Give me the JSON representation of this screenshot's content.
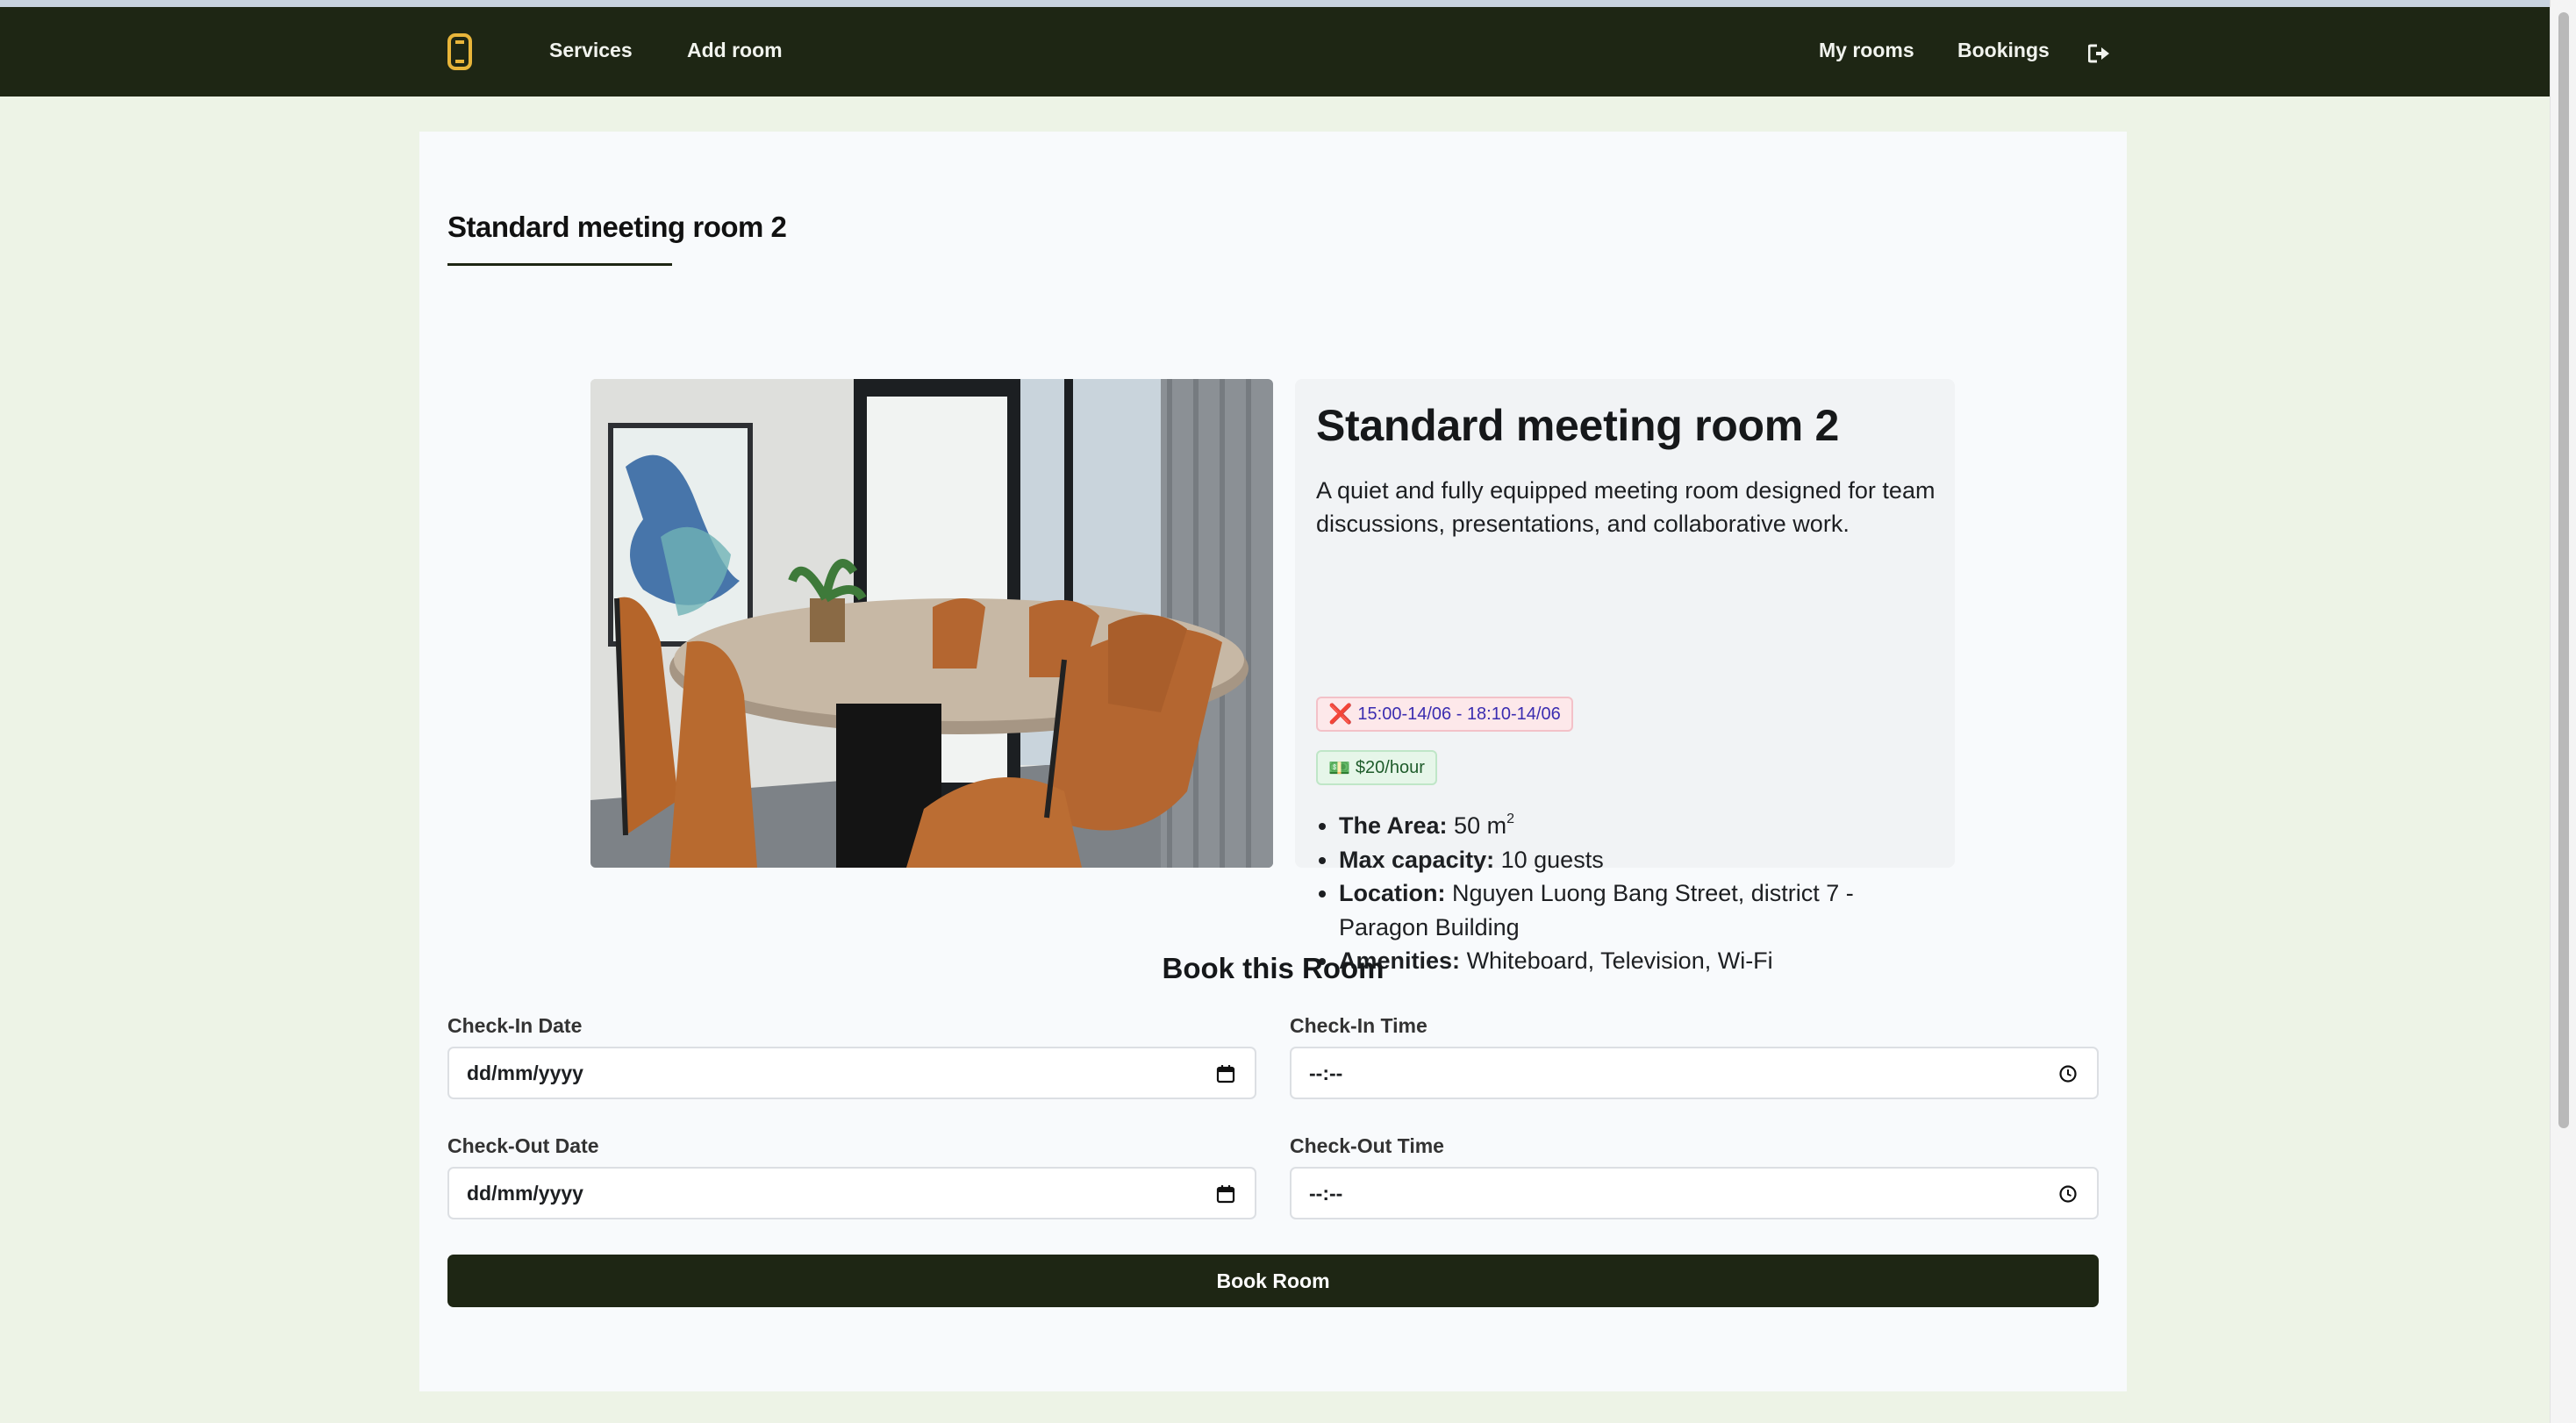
{
  "navbar": {
    "logo_icon": "link-logo-icon",
    "links": {
      "services": "Services",
      "add_room": "Add room",
      "my_rooms": "My rooms",
      "bookings": "Bookings"
    },
    "logout_icon": "sign-out-icon"
  },
  "page": {
    "title": "Standard meeting room 2"
  },
  "room": {
    "name": "Standard meeting room 2",
    "description": "A quiet and fully equipped meeting room designed for team discussions, presentations, and collaborative work.",
    "booked_slot": {
      "icon": "❌",
      "text": "15:00-14/06 - 18:10-14/06"
    },
    "price": {
      "icon": "💵",
      "text": "$20/hour"
    },
    "details": {
      "area_label": "The Area:",
      "area_value": "50 m",
      "area_unit_exp": "2",
      "capacity_label": "Max capacity:",
      "capacity_value": "10 guests",
      "location_label": "Location:",
      "location_value": "Nguyen Luong Bang Street, district 7 - Paragon Building",
      "amenities_label": "Amenities:",
      "amenities_value": "Whiteboard, Television, Wi-Fi"
    }
  },
  "booking": {
    "heading": "Book this Room",
    "check_in_date": {
      "label": "Check-In Date",
      "value": "dd/mm/yyyy",
      "icon": "calendar-icon"
    },
    "check_in_time": {
      "label": "Check-In Time",
      "value": "--:--",
      "icon": "clock-icon"
    },
    "check_out_date": {
      "label": "Check-Out Date",
      "value": "dd/mm/yyyy",
      "icon": "calendar-icon"
    },
    "check_out_time": {
      "label": "Check-Out Time",
      "value": "--:--",
      "icon": "clock-icon"
    },
    "submit_label": "Book Room"
  },
  "colors": {
    "nav_bg": "#1e2614",
    "page_bg": "#edf3e6",
    "accent": "#e8b53a",
    "card_bg": "#f8fafc"
  }
}
